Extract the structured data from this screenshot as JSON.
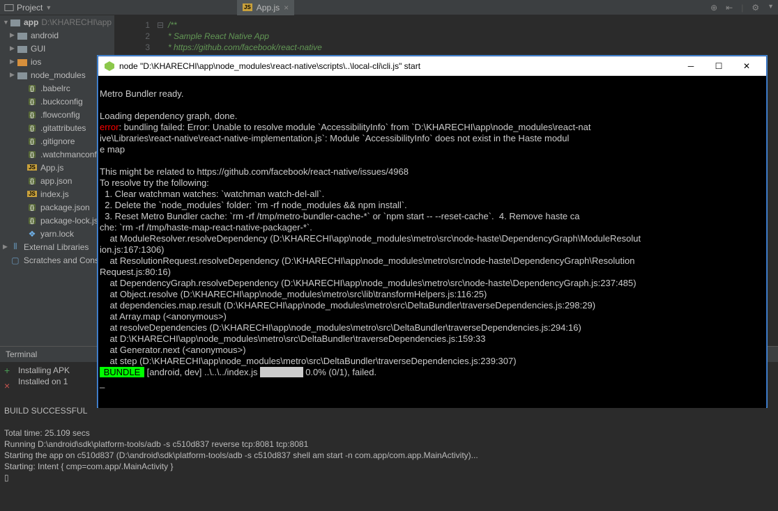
{
  "toolbar": {
    "project_label": "Project",
    "icons": [
      "target-icon",
      "sync-icon",
      "divider",
      "gear-icon",
      "divider2"
    ]
  },
  "editor_tab": {
    "label": "App.js"
  },
  "tree": {
    "root": {
      "name": "app",
      "path": "D:\\KHARECHI\\app"
    },
    "items": [
      {
        "name": "android",
        "type": "folder",
        "color": "gray"
      },
      {
        "name": "GUI",
        "type": "folder",
        "color": "gray"
      },
      {
        "name": "ios",
        "type": "folder",
        "color": "orange"
      },
      {
        "name": "node_modules",
        "type": "folder",
        "color": "gray"
      },
      {
        "name": ".babelrc",
        "type": "file"
      },
      {
        "name": ".buckconfig",
        "type": "file"
      },
      {
        "name": ".flowconfig",
        "type": "file"
      },
      {
        "name": ".gitattributes",
        "type": "file"
      },
      {
        "name": ".gitignore",
        "type": "file"
      },
      {
        "name": ".watchmanconfig",
        "type": "file"
      },
      {
        "name": "App.js",
        "type": "file"
      },
      {
        "name": "app.json",
        "type": "file"
      },
      {
        "name": "index.js",
        "type": "file"
      },
      {
        "name": "package.json",
        "type": "file"
      },
      {
        "name": "package-lock.json",
        "type": "file"
      },
      {
        "name": "yarn.lock",
        "type": "file"
      }
    ],
    "extlib": "External Libraries",
    "scratches": "Scratches and Consoles"
  },
  "editor": {
    "lines": [
      {
        "n": "1",
        "c": "/**"
      },
      {
        "n": "2",
        "c": " * Sample React Native App"
      },
      {
        "n": "3",
        "c": " * https://github.com/facebook/react-native"
      }
    ]
  },
  "terminal": {
    "title": "Terminal",
    "lines_top": [
      "Installing APK ",
      "Installed on 1 "
    ],
    "lines_bottom": [
      "BUILD SUCCESSFUL",
      "",
      "Total time: 25.109 secs",
      "Running D:\\android\\sdk\\platform-tools/adb -s c510d837 reverse tcp:8081 tcp:8081",
      "Starting the app on c510d837 (D:\\android\\sdk\\platform-tools/adb -s c510d837 shell am start -n com.app/com.app.MainActivity)...",
      "Starting: Intent { cmp=com.app/.MainActivity }",
      "▯"
    ]
  },
  "console": {
    "title": "node  \"D:\\KHARECHI\\app\\node_modules\\react-native\\scripts\\..\\local-cli\\cli.js\" start",
    "lines": [
      {
        "t": "",
        "c": ""
      },
      {
        "t": "Metro Bundler ready.",
        "c": ""
      },
      {
        "t": "",
        "c": ""
      },
      {
        "t": "Loading dependency graph, done.",
        "c": ""
      }
    ],
    "error_label": "error",
    "error_rest": ": bundling failed: Error: Unable to resolve module `AccessibilityInfo` from `D:\\KHARECHI\\app\\node_modules\\react-nat",
    "error_lines": [
      "ive\\Libraries\\react-native\\react-native-implementation.js`: Module `AccessibilityInfo` does not exist in the Haste modul",
      "e map",
      "",
      "This might be related to https://github.com/facebook/react-native/issues/4968",
      "To resolve try the following:",
      "  1. Clear watchman watches: `watchman watch-del-all`.",
      "  2. Delete the `node_modules` folder: `rm -rf node_modules && npm install`.",
      "  3. Reset Metro Bundler cache: `rm -rf /tmp/metro-bundler-cache-*` or `npm start -- --reset-cache`.  4. Remove haste ca",
      "che: `rm -rf /tmp/haste-map-react-native-packager-*`.",
      "    at ModuleResolver.resolveDependency (D:\\KHARECHI\\app\\node_modules\\metro\\src\\node-haste\\DependencyGraph\\ModuleResolut",
      "ion.js:167:1306)",
      "    at ResolutionRequest.resolveDependency (D:\\KHARECHI\\app\\node_modules\\metro\\src\\node-haste\\DependencyGraph\\Resolution",
      "Request.js:80:16)",
      "    at DependencyGraph.resolveDependency (D:\\KHARECHI\\app\\node_modules\\metro\\src\\node-haste\\DependencyGraph.js:237:485)",
      "    at Object.resolve (D:\\KHARECHI\\app\\node_modules\\metro\\src\\lib\\transformHelpers.js:116:25)",
      "    at dependencies.map.result (D:\\KHARECHI\\app\\node_modules\\metro\\src\\DeltaBundler\\traverseDependencies.js:298:29)",
      "    at Array.map (<anonymous>)",
      "    at resolveDependencies (D:\\KHARECHI\\app\\node_modules\\metro\\src\\DeltaBundler\\traverseDependencies.js:294:16)",
      "    at D:\\KHARECHI\\app\\node_modules\\metro\\src\\DeltaBundler\\traverseDependencies.js:159:33",
      "    at Generator.next (<anonymous>)",
      "    at step (D:\\KHARECHI\\app\\node_modules\\metro\\src\\DeltaBundler\\traverseDependencies.js:239:307)"
    ],
    "bundle_label": " BUNDLE ",
    "bundle_rest": " [android, dev] ..\\..\\../index.js ",
    "bundle_progress": "                 ",
    "bundle_stats": " 0.0% (0/1), failed."
  }
}
